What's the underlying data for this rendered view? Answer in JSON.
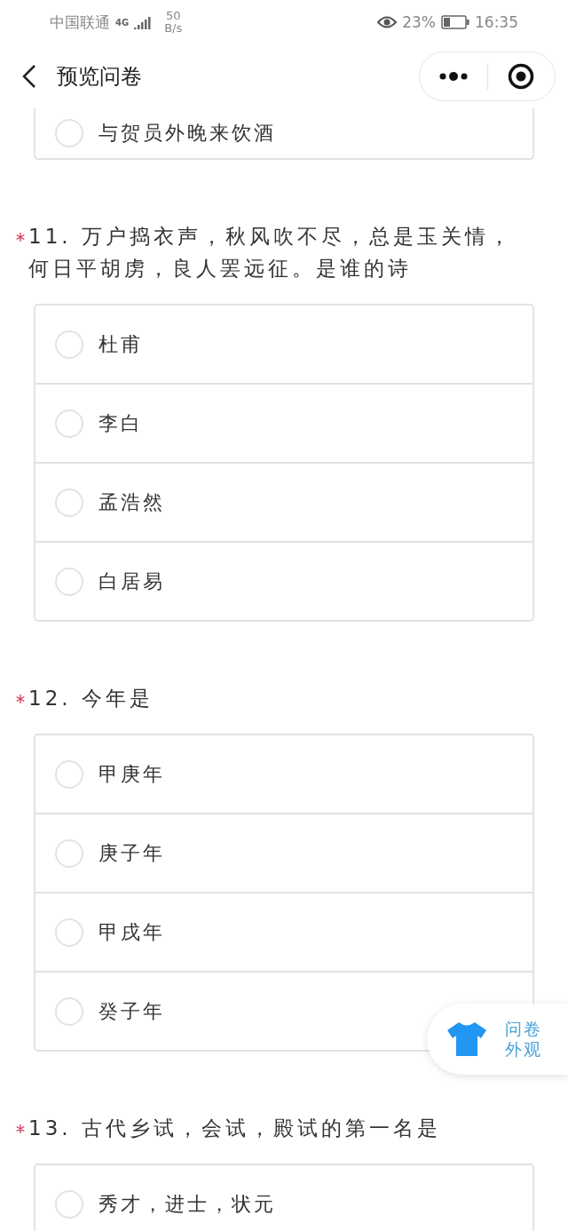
{
  "status_bar": {
    "carrier": "中国联通",
    "network": "4G",
    "speed_value": "50",
    "speed_unit": "B/s",
    "battery_percent": "23%",
    "time": "16:35"
  },
  "nav": {
    "title": "预览问卷"
  },
  "partial_question": {
    "options": [
      {
        "label": "与贺员外晚来饮酒",
        "selected": false
      }
    ]
  },
  "questions": [
    {
      "title": "11. 万户捣衣声，秋风吹不尽，总是玉关情，何日平胡虏，良人罢远征。是谁的诗",
      "required": true,
      "options": [
        {
          "label": "杜甫",
          "selected": false
        },
        {
          "label": "李白",
          "selected": false
        },
        {
          "label": "孟浩然",
          "selected": false
        },
        {
          "label": "白居易",
          "selected": false
        }
      ]
    },
    {
      "title": "12. 今年是",
      "required": true,
      "options": [
        {
          "label": "甲庚年",
          "selected": false
        },
        {
          "label": "庚子年",
          "selected": false
        },
        {
          "label": "甲戌年",
          "selected": false
        },
        {
          "label": "癸子年",
          "selected": false
        }
      ]
    },
    {
      "title": "13. 古代乡试，会试，殿试的第一名是",
      "required": true,
      "options": [
        {
          "label": "秀才，进士，状元",
          "selected": false
        }
      ]
    }
  ],
  "appearance_button": {
    "label": "问卷外观"
  }
}
